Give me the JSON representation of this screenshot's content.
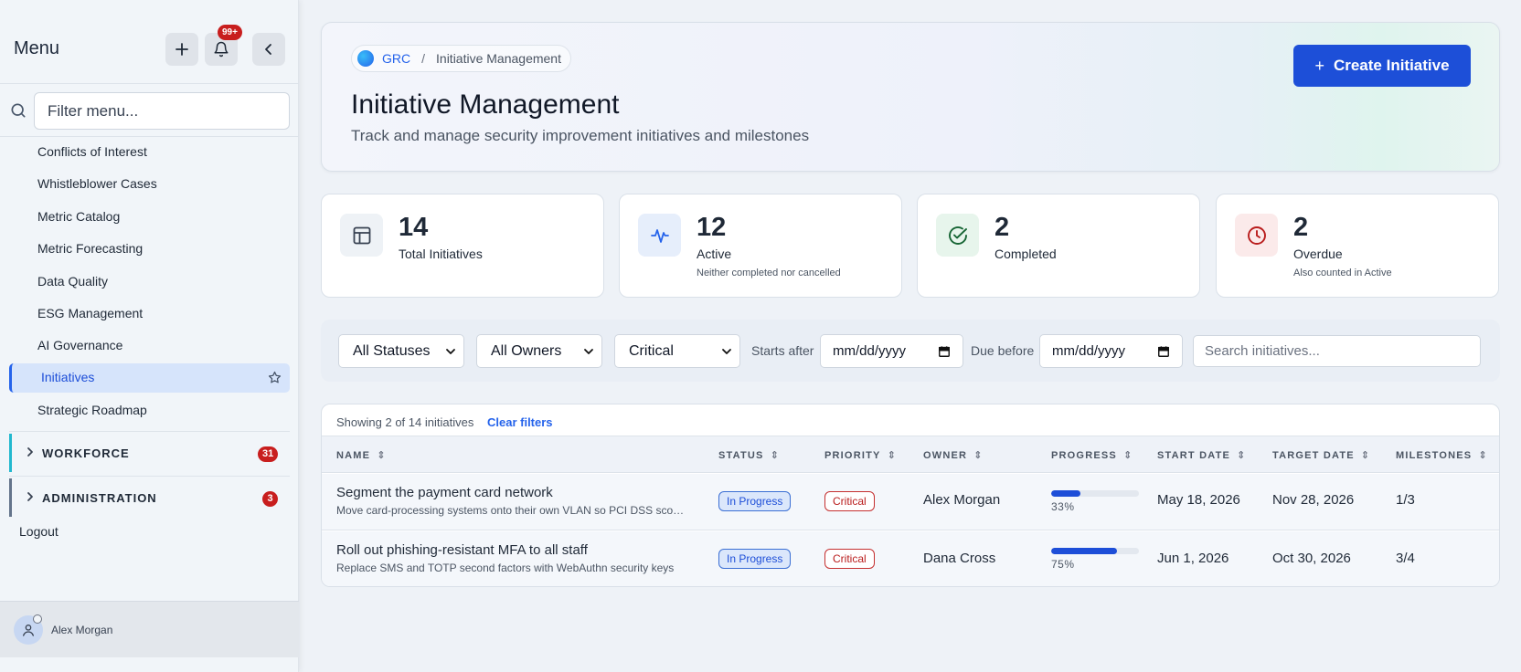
{
  "sidebar": {
    "title": "Menu",
    "notification_badge": "99+",
    "filter_placeholder": "Filter menu...",
    "items": [
      {
        "label": "Conflicts of Interest"
      },
      {
        "label": "Whistleblower Cases"
      },
      {
        "label": "Metric Catalog"
      },
      {
        "label": "Metric Forecasting"
      },
      {
        "label": "Data Quality"
      },
      {
        "label": "ESG Management"
      },
      {
        "label": "AI Governance"
      },
      {
        "label": "Initiatives"
      },
      {
        "label": "Strategic Roadmap"
      }
    ],
    "sections": [
      {
        "label": "WORKFORCE",
        "count": "31",
        "accent": "#22b8cf"
      },
      {
        "label": "ADMINISTRATION",
        "count": "3",
        "accent": "#64748b"
      }
    ],
    "logout_label": "Logout",
    "user_name": "Alex Morgan"
  },
  "header": {
    "breadcrumb_root": "GRC",
    "breadcrumb_sep": "/",
    "breadcrumb_current": "Initiative Management",
    "title": "Initiative Management",
    "subtitle": "Track and manage security improvement initiatives and milestones",
    "create_button_label": "Create Initiative",
    "create_button_plus": "+"
  },
  "stats": [
    {
      "value": "14",
      "label": "Total Initiatives",
      "note": "",
      "icon": "table-icon",
      "color": "#1f2937"
    },
    {
      "value": "12",
      "label": "Active",
      "note": "Neither completed nor cancelled",
      "icon": "activity-icon",
      "color": "#2563eb"
    },
    {
      "value": "2",
      "label": "Completed",
      "note": "",
      "icon": "check-circle-icon",
      "color": "#15803d"
    },
    {
      "value": "2",
      "label": "Overdue",
      "note": "Also counted in Active",
      "icon": "clock-icon",
      "color": "#b91c1c"
    }
  ],
  "filters": {
    "status_value": "All Statuses",
    "owner_value": "All Owners",
    "priority_value": "Critical",
    "starts_after_label": "Starts after",
    "due_before_label": "Due before",
    "date_placeholder": "mm/dd/yyyy",
    "search_placeholder": "Search initiatives..."
  },
  "table": {
    "showing_text": "Showing 2 of 14 initiatives",
    "clear_filters": "Clear filters",
    "columns": [
      "NAME",
      "STATUS",
      "PRIORITY",
      "OWNER",
      "PROGRESS",
      "START DATE",
      "TARGET DATE",
      "MILESTONES"
    ],
    "rows": [
      {
        "name": "Segment the payment card network",
        "description": "Move card-processing systems onto their own VLAN so PCI DSS scope is reduced",
        "status": "In Progress",
        "priority": "Critical",
        "owner": "Alex Morgan",
        "progress": 33,
        "progress_label": "33%",
        "start_date": "May 18, 2026",
        "target_date": "Nov 28, 2026",
        "milestones": "1/3"
      },
      {
        "name": "Roll out phishing-resistant MFA to all staff",
        "description": "Replace SMS and TOTP second factors with WebAuthn security keys",
        "status": "In Progress",
        "priority": "Critical",
        "owner": "Dana Cross",
        "progress": 75,
        "progress_label": "75%",
        "start_date": "Jun 1, 2026",
        "target_date": "Oct 30, 2026",
        "milestones": "3/4"
      }
    ]
  },
  "colors": {
    "accent": "#1d4fd8",
    "danger": "#c81e1e"
  }
}
